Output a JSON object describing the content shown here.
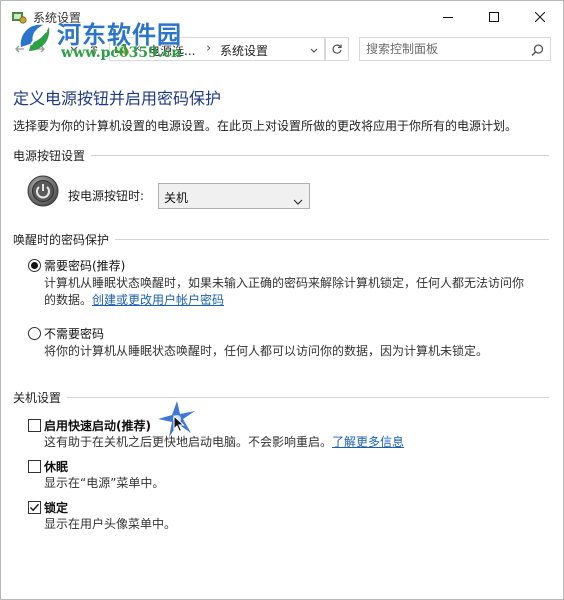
{
  "window": {
    "title": "系统设置"
  },
  "watermark": {
    "site_name": "河东软件园",
    "url": "www.pc0359.cn"
  },
  "address_bar": {
    "crumb_collapsed": "«",
    "crumb_parent": "电源选...",
    "crumb_current": "系统设置",
    "search_placeholder": "搜索控制面板"
  },
  "page": {
    "title": "定义电源按钮并启用密码保护",
    "description": "选择要为你的计算机设置的电源设置。在此页上对设置所做的更改将应用于你所有的电源计划。"
  },
  "power_button": {
    "section_label": "电源按钮设置",
    "select_label": "按电源按钮时:",
    "select_value": "关机"
  },
  "wake_password": {
    "section_label": "唤醒时的密码保护",
    "options": [
      {
        "label": "需要密码(推荐)",
        "selected": true,
        "desc_line1": "计算机从睡眠状态唤醒时，如果未输入正确的密码来解除计算机锁定，任何人都无法访问你",
        "desc_line2": "的数据。",
        "link": "创建或更改用户帐户密码"
      },
      {
        "label": "不需要密码",
        "selected": false,
        "desc_line1": "将你的计算机从睡眠状态唤醒时，任何人都可以访问你的数据，因为计算机未锁定。"
      }
    ]
  },
  "shutdown": {
    "section_label": "关机设置",
    "items": [
      {
        "label": "启用快速启动(推荐)",
        "checked": false,
        "desc": "这有助于在关机之后更快地启动电脑。不会影响重启。",
        "link": "了解更多信息"
      },
      {
        "label": "休眠",
        "checked": false,
        "desc": "显示在“电源”菜单中。"
      },
      {
        "label": "锁定",
        "checked": true,
        "desc": "显示在用户头像菜单中。"
      }
    ]
  },
  "colors": {
    "title_blue": "#1e3a8a",
    "link_blue": "#1a5fb4",
    "watermark_blue": "#2a74c9",
    "watermark_green": "#2ea045"
  },
  "icons": {
    "title": "settings-app-icon",
    "power": "power-button-icon",
    "search": "search-icon",
    "refresh": "refresh-icon",
    "back": "back-arrow-icon",
    "forward": "forward-arrow-icon",
    "up": "up-arrow-icon"
  }
}
